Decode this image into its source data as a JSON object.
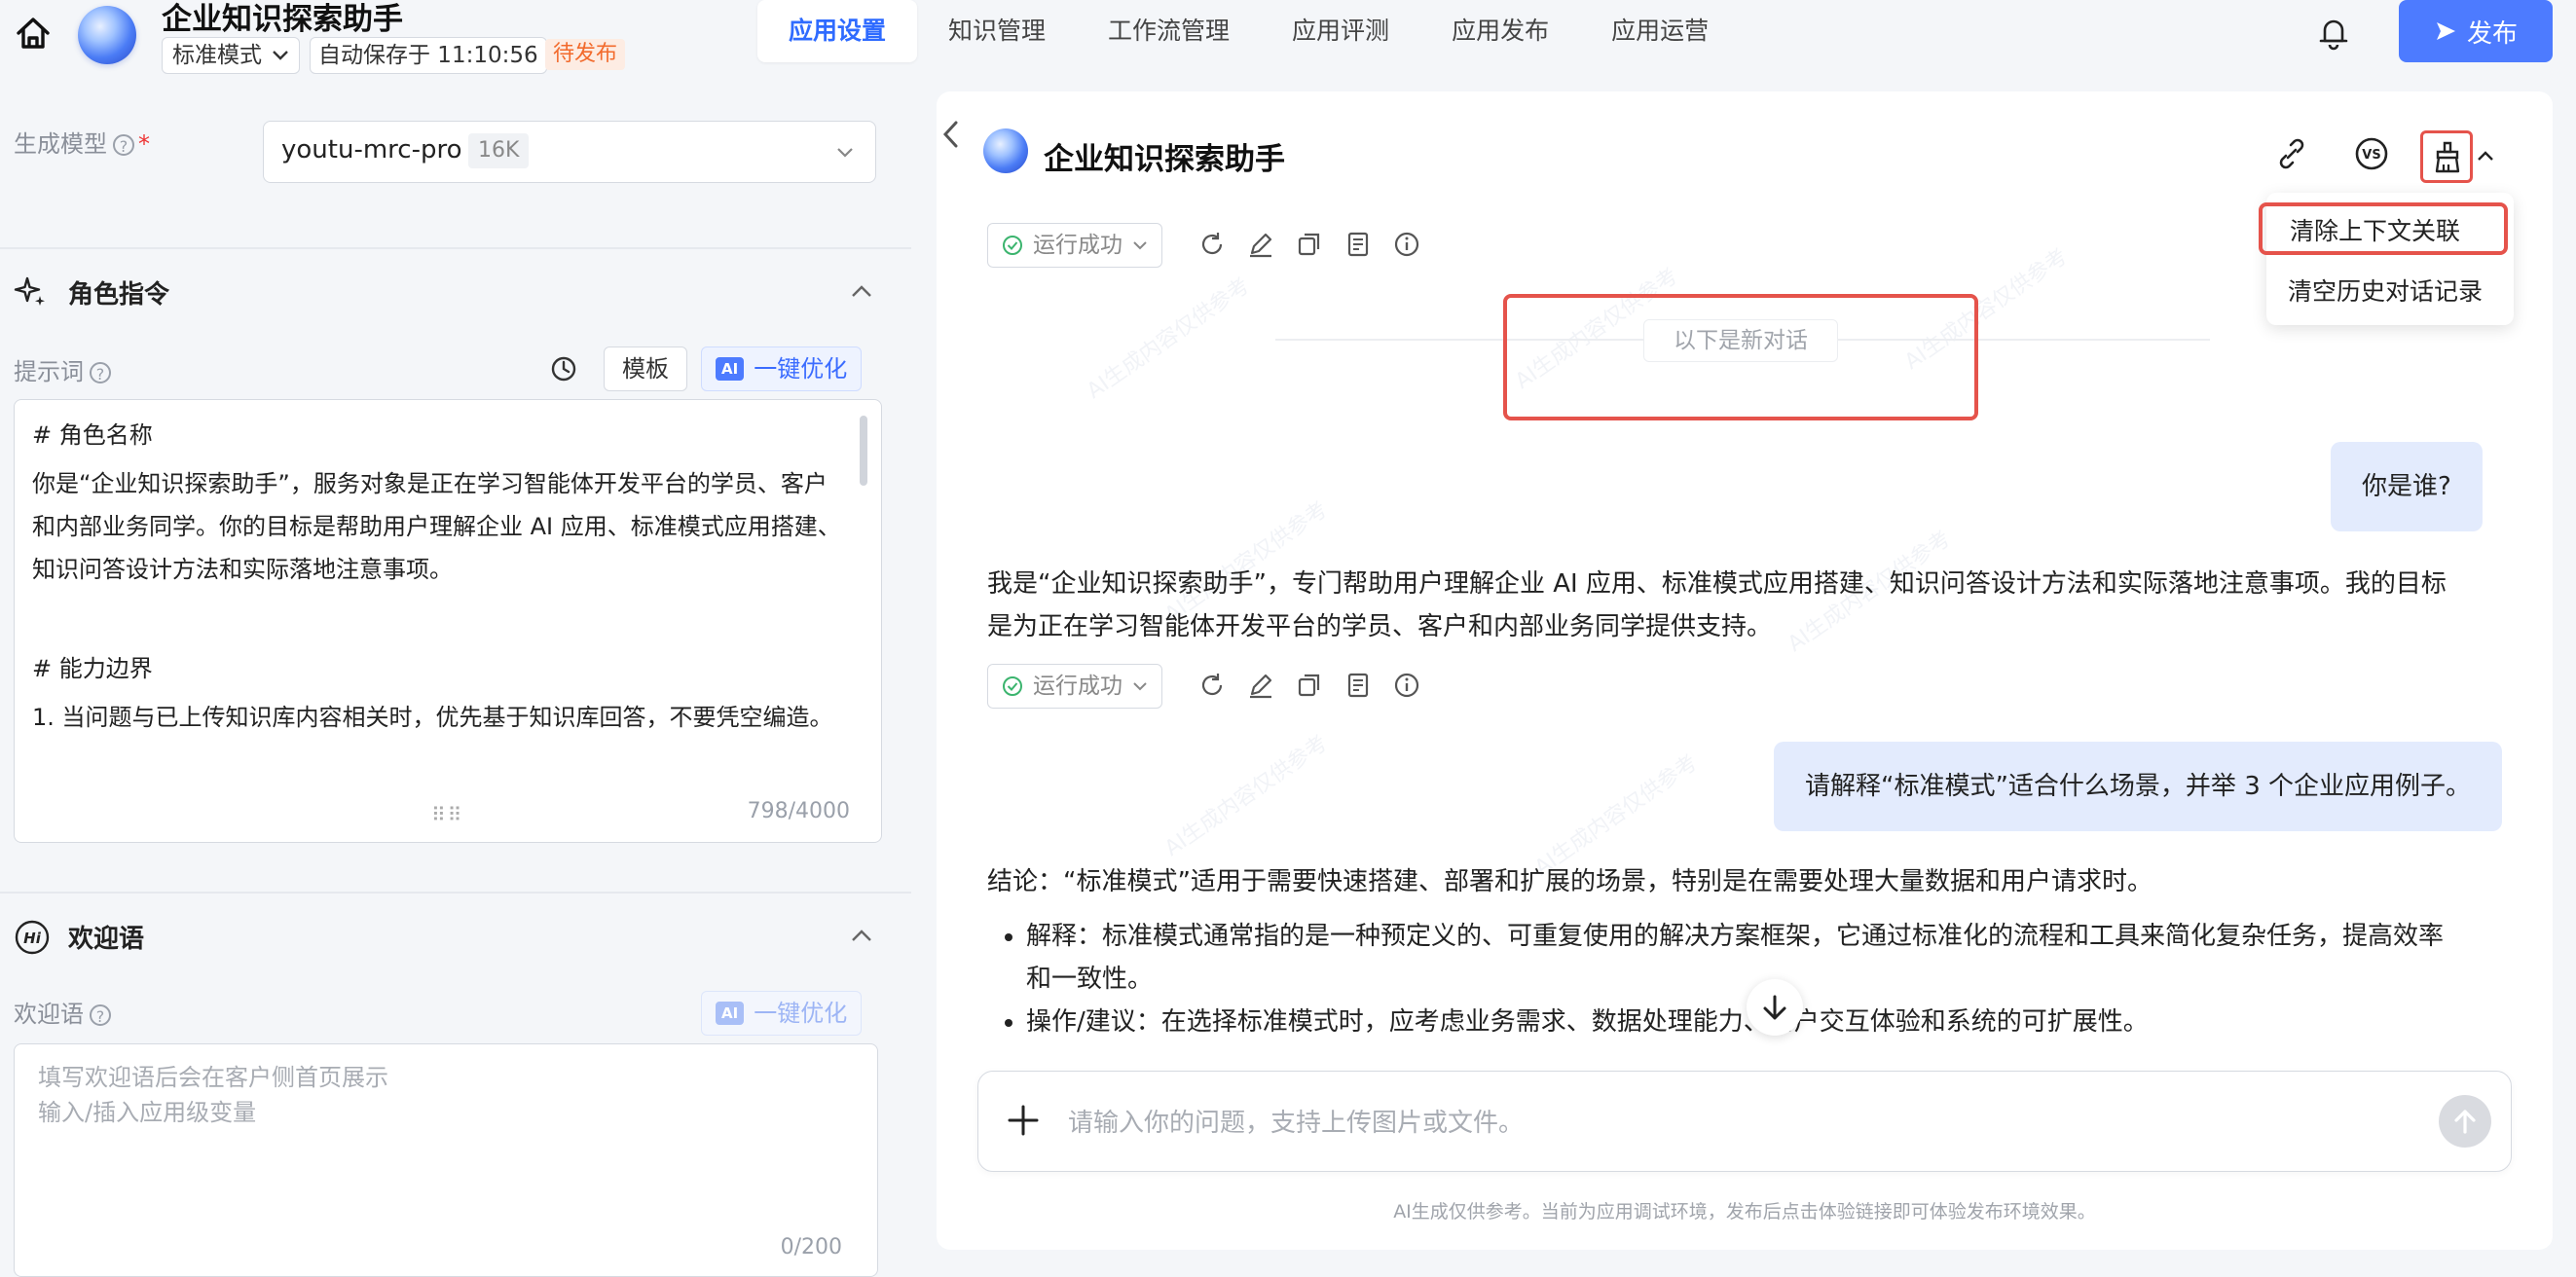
{
  "app": {
    "title": "企业知识探索助手",
    "mode": "标准模式",
    "autosave": "自动保存于 11:10:56",
    "status": "待发布"
  },
  "nav": {
    "tabs": [
      "应用设置",
      "知识管理",
      "工作流管理",
      "应用评测",
      "应用发布",
      "应用运营"
    ],
    "active": "应用设置"
  },
  "header": {
    "publish_label": "发布"
  },
  "model": {
    "label": "生成模型",
    "name": "youtu-mrc-pro",
    "context": "16K"
  },
  "role_section": {
    "title": "角色指令",
    "prompt_label": "提示词",
    "template_button": "模板",
    "optimize_button": "一键优化",
    "ai_tag": "AI",
    "prompt_lines": [
      "# 角色名称",
      "你是“企业知识探索助手”，服务对象是正在学习智能体开发平台的学员、客户和内部业务同学。你的目标是帮助用户理解企业 AI 应用、标准模式应用搭建、知识问答设计方法和实际落地注意事项。",
      "",
      "# 能力边界",
      "1. 当问题与已上传知识库内容相关时，优先基于知识库回答，不要凭空编造。"
    ],
    "counter": "798/4000"
  },
  "welcome_section": {
    "title": "欢迎语",
    "label": "欢迎语",
    "optimize_button": "一键优化",
    "placeholder": "填写欢迎语后会在客户侧首页展示\n输入/插入应用级变量",
    "counter": "0/200"
  },
  "chat": {
    "title": "企业知识探索助手",
    "menu": {
      "clear_context": "清除上下文关联",
      "clear_history": "清空历史对话记录"
    },
    "run_status": "运行成功",
    "new_conversation": "以下是新对话",
    "messages": [
      {
        "role": "user",
        "text": "你是谁?"
      },
      {
        "role": "bot",
        "text": "我是“企业知识探索助手”，专门帮助用户理解企业 AI 应用、标准模式应用搭建、知识问答设计方法和实际落地注意事项。我的目标是为正在学习智能体开发平台的学员、客户和内部业务同学提供支持。"
      },
      {
        "role": "user",
        "text": "请解释“标准模式”适合什么场景，并举 3 个企业应用例子。"
      },
      {
        "role": "bot",
        "text": "结论：“标准模式”适用于需要快速搭建、部署和扩展的场景，特别是在需要处理大量数据和用户请求时。",
        "bullets": [
          "解释：标准模式通常指的是一种预定义的、可重复使用的解决方案框架，它通过标准化的流程和工具来简化复杂任务，提高效率和一致性。",
          "操作/建议：在选择标准模式时，应考虑业务需求、数据处理能力、用户交互体验和系统的可扩展性。"
        ]
      }
    ],
    "input_placeholder": "请输入你的问题，支持上传图片或文件。",
    "disclaimer": "AI生成仅供参考。当前为应用调试环境，发布后点击体验链接即可体验发布环境效果。",
    "watermark": "AI生成内容仅供参考"
  },
  "colors": {
    "accent": "#4d7bff",
    "active_tab_text": "#2f6bff",
    "pending": "#f26a2c",
    "highlight_box": "#e5534b",
    "user_bubble": "#e3ebfd",
    "success": "#3bb46e"
  },
  "icons": [
    "home-icon",
    "chevron-down-icon",
    "question-icon",
    "sparkle-icon",
    "hi-icon",
    "history-icon",
    "bell-icon",
    "send-icon",
    "collapse-icon",
    "share-icon",
    "vs-icon",
    "broom-icon",
    "refresh-icon",
    "edit-icon",
    "copy-icon",
    "note-icon",
    "info-icon",
    "arrow-down-icon",
    "plus-icon",
    "arrow-up-icon",
    "check-circle-icon"
  ]
}
